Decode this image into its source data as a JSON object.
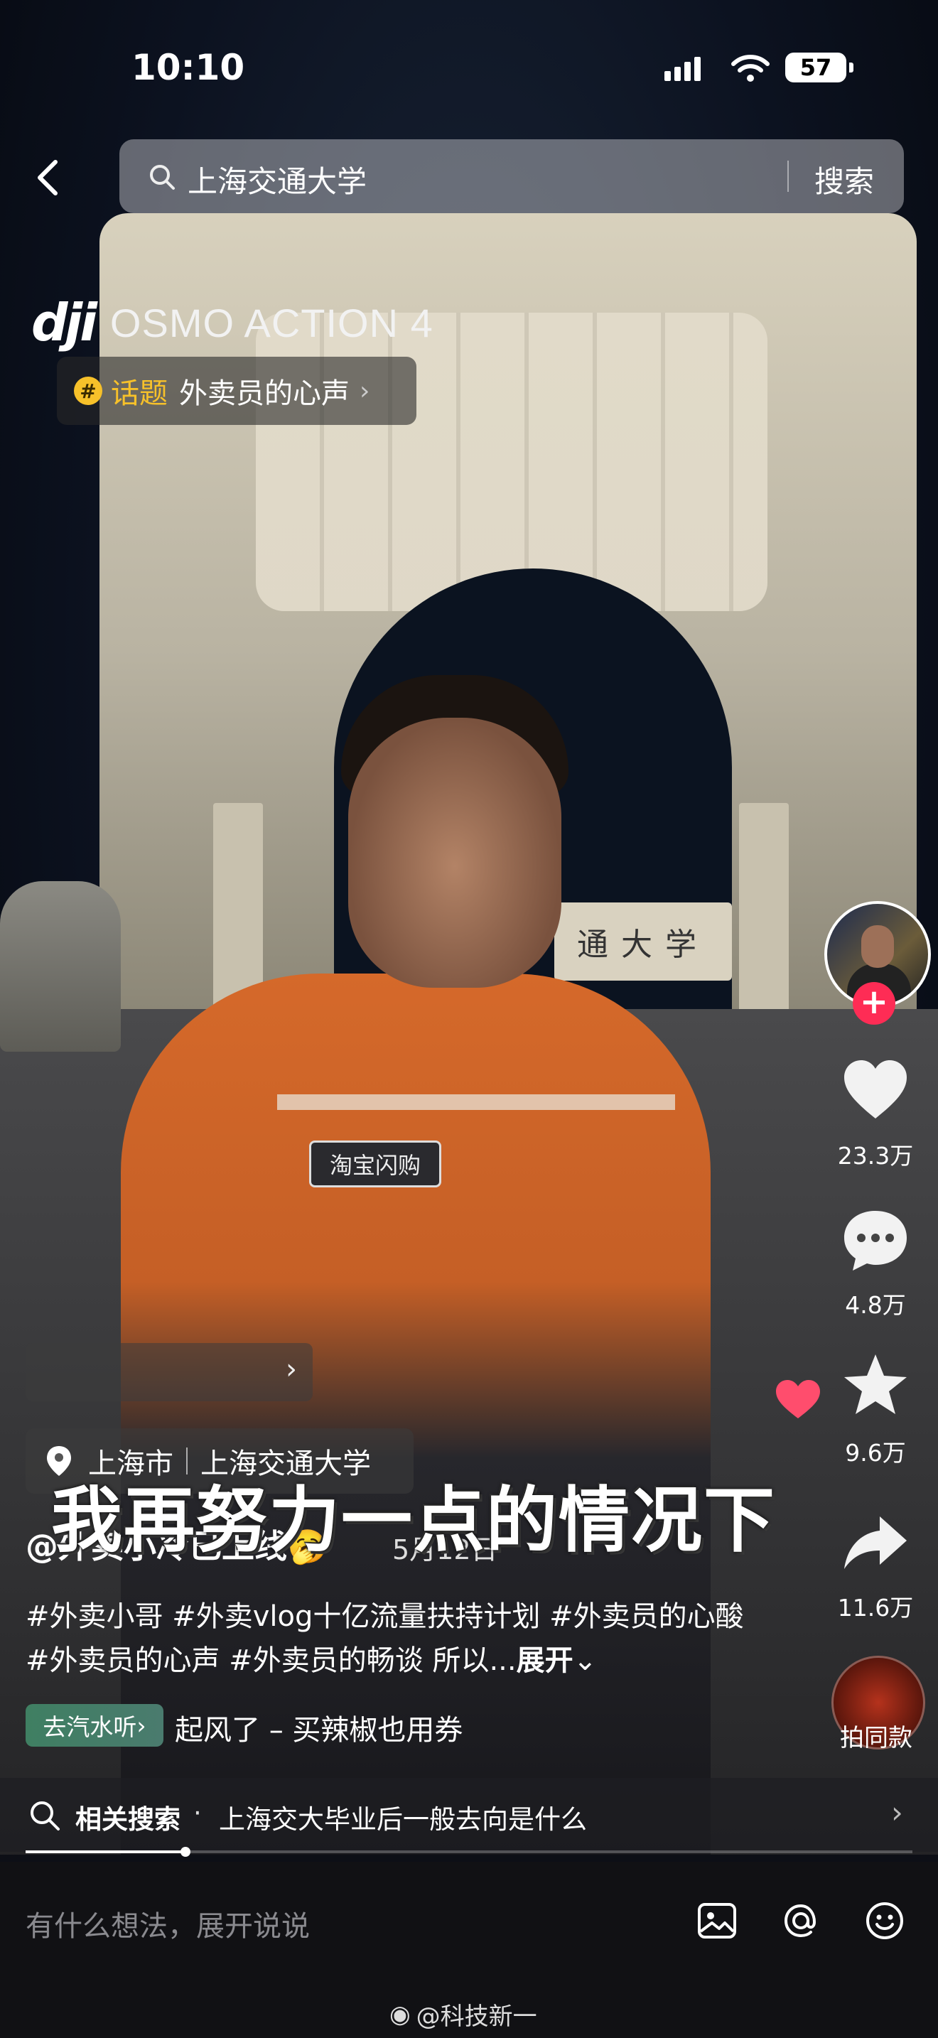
{
  "status_bar": {
    "time": "10:10",
    "battery": "57"
  },
  "search": {
    "query": "上海交通大学",
    "button": "搜索"
  },
  "brand": {
    "logo": "dji",
    "model": "OSMO ACTION 4"
  },
  "topic": {
    "icon": "#",
    "label": "话题",
    "name": "外卖员的心声"
  },
  "video": {
    "sign_text": "通大学",
    "patch_text": "淘宝闪购"
  },
  "actions": {
    "likes": "23.3万",
    "comments": "4.8万",
    "favorites": "9.6万",
    "shares": "11.6万",
    "same_style": "拍同款"
  },
  "location": {
    "city": "上海市",
    "place": "上海交通大学"
  },
  "subtitle": "我再努力一点的情况下",
  "author": {
    "handle": "@外卖小冷已上线🥱",
    "date": "5月12日"
  },
  "description": {
    "text": "#外卖小哥 #外卖vlog十亿流量扶持计划 #外卖员的心酸 #外卖员的心声 #外卖员的畅谈 所以...",
    "more": "展开"
  },
  "music": {
    "tag": "去汽水听",
    "title": "起风了 – 买辣椒也用券"
  },
  "related": {
    "label": "相关搜索",
    "separator": "·",
    "query": "上海交大毕业后一般去向是什么"
  },
  "progress": {
    "fraction": 0.18
  },
  "comment": {
    "placeholder": "有什么想法，展开说说"
  },
  "watermark": "@科技新一",
  "colors": {
    "accent_red": "#fe2c55",
    "topic_yellow": "#f7c12a"
  }
}
